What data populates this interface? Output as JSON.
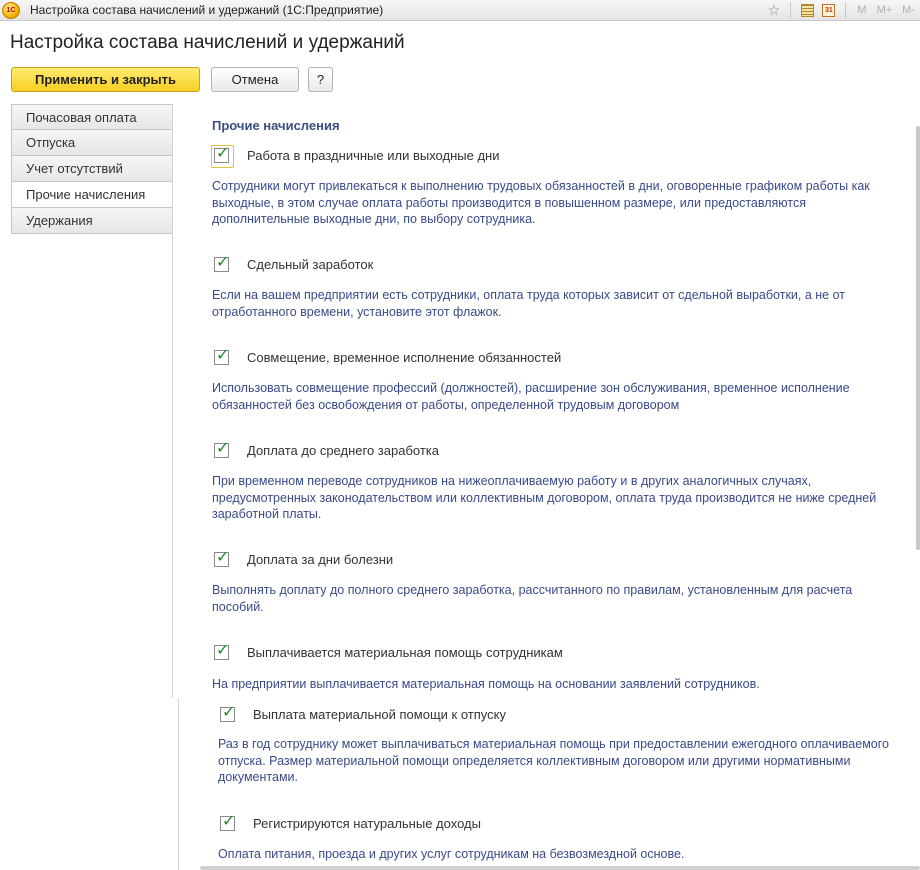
{
  "window": {
    "title": "Настройка состава начислений и удержаний  (1С:Предприятие)",
    "logo": "1С",
    "icons": [
      "favorites-star-icon",
      "calculator-icon",
      "calendar-icon"
    ],
    "calendar_label": "31",
    "memory_buttons": [
      "M",
      "M+",
      "M-"
    ]
  },
  "page": {
    "title": "Настройка состава начислений и удержаний"
  },
  "toolbar": {
    "apply_label": "Применить и закрыть",
    "cancel_label": "Отмена",
    "help_label": "?"
  },
  "tabs": [
    {
      "label": "Почасовая оплата",
      "active": false
    },
    {
      "label": "Отпуска",
      "active": false
    },
    {
      "label": "Учет отсутствий",
      "active": false
    },
    {
      "label": "Прочие начисления",
      "active": true
    },
    {
      "label": "Удержания",
      "active": false
    }
  ],
  "section": {
    "title": "Прочие начисления",
    "items": [
      {
        "label": "Работа в праздничные или выходные дни",
        "checked": true,
        "description": "Сотрудники могут привлекаться к выполнению трудовых обязанностей в дни, оговоренные графиком работы как выходные, в этом случае оплата работы производится в повышенном размере, или предоставляются дополнительные выходные дни, по выбору сотрудника."
      },
      {
        "label": "Сдельный заработок",
        "checked": true,
        "description": "Если на вашем предприятии есть сотрудники, оплата труда которых зависит от сдельной выработки, а не от отработанного времени, установите этот флажок."
      },
      {
        "label": "Совмещение, временное исполнение обязанностей",
        "checked": true,
        "description": "Использовать совмещение профессий (должностей), расширение зон обслуживания, временное исполнение обязанностей без освобождения от работы, определенной трудовым договором"
      },
      {
        "label": "Доплата до среднего заработка",
        "checked": true,
        "description": "При временном переводе сотрудников на нижеоплачиваемую работу и в других аналогичных случаях, предусмотренных законодательством или коллективным договором, оплата труда производится не ниже средней заработной платы."
      },
      {
        "label": "Доплата за дни болезни",
        "checked": true,
        "description": "Выполнять доплату до полного среднего заработка, рассчитанного по правилам, установленным для расчета пособий."
      },
      {
        "label": "Выплачивается материальная помощь сотрудникам",
        "checked": true,
        "description": "На предприятии выплачивается материальная помощь на основании заявлений сотрудников."
      },
      {
        "label": "Выплата материальной помощи к отпуску",
        "checked": true,
        "description": "Раз в год сотруднику может выплачиваться материальная помощь при предоставлении ежегодного оплачиваемого отпуска. Размер материальной помощи определяется коллективным договором или другими нормативными документами."
      },
      {
        "label": "Регистрируются натуральные доходы",
        "checked": true,
        "description": "Оплата питания, проезда и других услуг сотрудникам на безвозмездной основе."
      }
    ]
  }
}
